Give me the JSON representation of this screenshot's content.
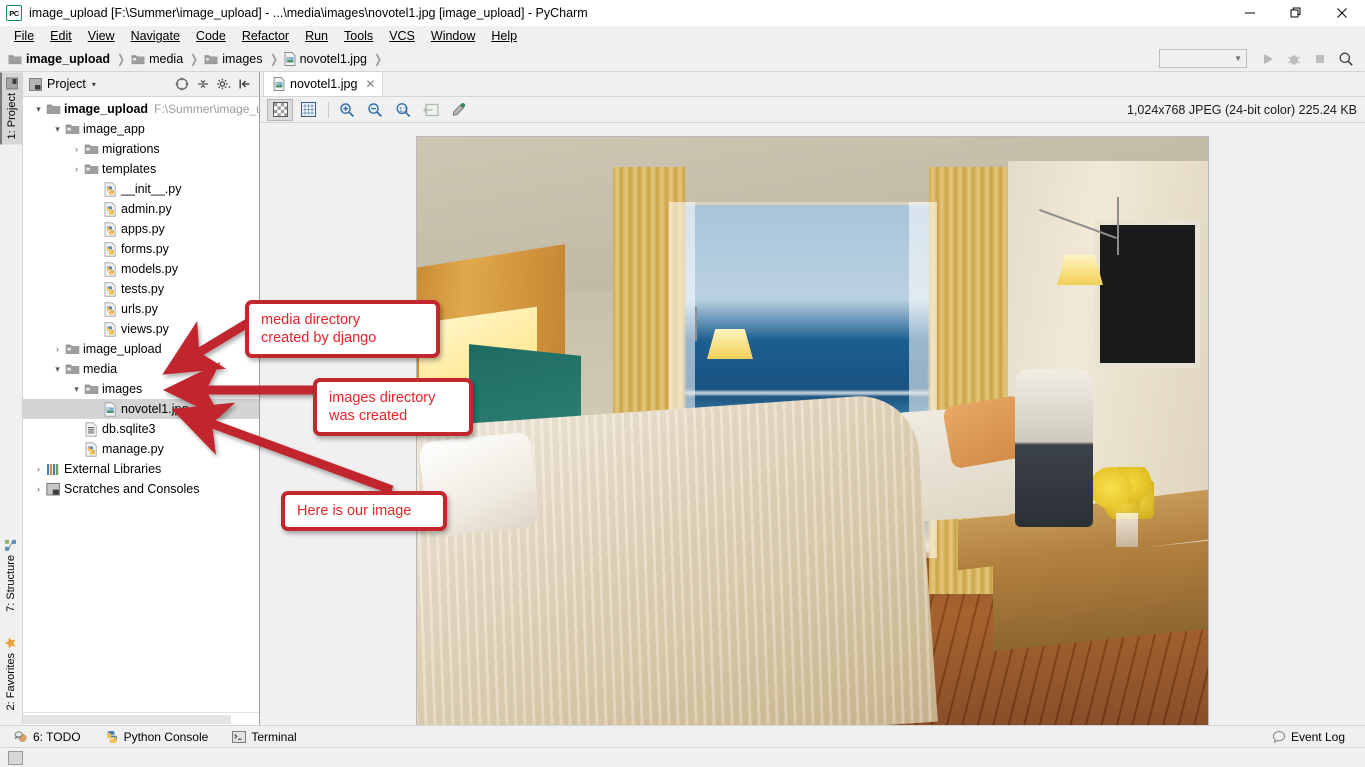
{
  "window": {
    "title": "image_upload [F:\\Summer\\image_upload] - ...\\media\\images\\novotel1.jpg [image_upload] - PyCharm",
    "app_icon_label": "PC",
    "minimize": "—",
    "maximize": "❐",
    "close": "✕"
  },
  "menubar": {
    "items": [
      {
        "label": "File"
      },
      {
        "label": "Edit"
      },
      {
        "label": "View"
      },
      {
        "label": "Navigate"
      },
      {
        "label": "Code"
      },
      {
        "label": "Refactor"
      },
      {
        "label": "Run"
      },
      {
        "label": "Tools"
      },
      {
        "label": "VCS"
      },
      {
        "label": "Window"
      },
      {
        "label": "Help"
      }
    ]
  },
  "navbar": {
    "breadcrumbs": [
      {
        "label": "image_upload",
        "icon": "folder-icon",
        "bold": true
      },
      {
        "label": "media",
        "icon": "folder-icon",
        "bold": false
      },
      {
        "label": "images",
        "icon": "folder-icon",
        "bold": false
      },
      {
        "label": "novotel1.jpg",
        "icon": "image-file-icon",
        "bold": false
      }
    ],
    "separator": "❯",
    "run_config_placeholder": "",
    "buttons": [
      {
        "name": "run-button",
        "label": "Run"
      },
      {
        "name": "debug-button",
        "label": "Debug"
      },
      {
        "name": "stop-button",
        "label": "Stop"
      },
      {
        "name": "search-everywhere-button",
        "label": "Search Everywhere"
      }
    ]
  },
  "left_stripe": {
    "top": [
      {
        "label": "1: Project",
        "icon": "project-icon",
        "active": true
      }
    ],
    "bottom": [
      {
        "label": "7: Structure",
        "icon": "structure-icon",
        "active": false
      },
      {
        "label": "2: Favorites",
        "icon": "favorites-star-icon",
        "active": false
      }
    ]
  },
  "project_panel": {
    "header_label": "Project",
    "header_caret": "▾",
    "tools": [
      "collapse-all-icon",
      "expand-all-icon",
      "settings-gear-icon",
      "hide-panel-icon"
    ],
    "tree": [
      {
        "label": "image_upload",
        "path": "F:\\Summer\\image_up",
        "indent": 0,
        "arrow": "▾",
        "icon": "folder-icon",
        "bold": true,
        "selected": false
      },
      {
        "label": "image_app",
        "path": "",
        "indent": 1,
        "arrow": "▾",
        "icon": "module-folder-icon",
        "bold": false,
        "selected": false
      },
      {
        "label": "migrations",
        "path": "",
        "indent": 2,
        "arrow": "›",
        "icon": "module-folder-icon",
        "bold": false,
        "selected": false
      },
      {
        "label": "templates",
        "path": "",
        "indent": 2,
        "arrow": "›",
        "icon": "module-folder-icon",
        "bold": false,
        "selected": false
      },
      {
        "label": "__init__.py",
        "path": "",
        "indent": 3,
        "arrow": "",
        "icon": "python-file-icon",
        "bold": false,
        "selected": false
      },
      {
        "label": "admin.py",
        "path": "",
        "indent": 3,
        "arrow": "",
        "icon": "python-file-icon",
        "bold": false,
        "selected": false
      },
      {
        "label": "apps.py",
        "path": "",
        "indent": 3,
        "arrow": "",
        "icon": "python-file-icon",
        "bold": false,
        "selected": false
      },
      {
        "label": "forms.py",
        "path": "",
        "indent": 3,
        "arrow": "",
        "icon": "python-file-icon",
        "bold": false,
        "selected": false
      },
      {
        "label": "models.py",
        "path": "",
        "indent": 3,
        "arrow": "",
        "icon": "python-file-icon",
        "bold": false,
        "selected": false
      },
      {
        "label": "tests.py",
        "path": "",
        "indent": 3,
        "arrow": "",
        "icon": "python-file-icon",
        "bold": false,
        "selected": false
      },
      {
        "label": "urls.py",
        "path": "",
        "indent": 3,
        "arrow": "",
        "icon": "python-file-icon",
        "bold": false,
        "selected": false
      },
      {
        "label": "views.py",
        "path": "",
        "indent": 3,
        "arrow": "",
        "icon": "python-file-icon",
        "bold": false,
        "selected": false
      },
      {
        "label": "image_upload",
        "path": "",
        "indent": 1,
        "arrow": "›",
        "icon": "module-folder-icon",
        "bold": false,
        "selected": false
      },
      {
        "label": "media",
        "path": "",
        "indent": 1,
        "arrow": "▾",
        "icon": "module-folder-icon",
        "bold": false,
        "selected": false
      },
      {
        "label": "images",
        "path": "",
        "indent": 2,
        "arrow": "▾",
        "icon": "module-folder-icon",
        "bold": false,
        "selected": false
      },
      {
        "label": "novotel1.jpg",
        "path": "",
        "indent": 3,
        "arrow": "",
        "icon": "image-file-icon",
        "bold": false,
        "selected": true
      },
      {
        "label": "db.sqlite3",
        "path": "",
        "indent": 2,
        "arrow": "",
        "icon": "db-file-icon",
        "bold": false,
        "selected": false
      },
      {
        "label": "manage.py",
        "path": "",
        "indent": 2,
        "arrow": "",
        "icon": "python-file-icon",
        "bold": false,
        "selected": false
      },
      {
        "label": "External Libraries",
        "path": "",
        "indent": 0,
        "arrow": "›",
        "icon": "libraries-icon",
        "bold": false,
        "selected": false
      },
      {
        "label": "Scratches and Consoles",
        "path": "",
        "indent": 0,
        "arrow": "›",
        "icon": "scratches-icon",
        "bold": false,
        "selected": false
      }
    ]
  },
  "editor": {
    "tab": {
      "label": "novotel1.jpg",
      "icon": "image-file-icon",
      "close": "✕"
    },
    "image_toolbar": [
      {
        "name": "toggle-transparency-grid-button",
        "icon": "checkerboard-icon",
        "pressed": true,
        "disabled": false
      },
      {
        "name": "toggle-grid-button",
        "icon": "grid-icon",
        "pressed": false,
        "disabled": false
      },
      {
        "name": "zoom-in-button",
        "icon": "zoom-in-icon",
        "pressed": false,
        "disabled": false
      },
      {
        "name": "zoom-out-button",
        "icon": "zoom-out-icon",
        "pressed": false,
        "disabled": false
      },
      {
        "name": "actual-size-button",
        "icon": "zoom-actual-size-icon",
        "pressed": false,
        "disabled": false
      },
      {
        "name": "fit-to-window-button",
        "icon": "fit-window-icon",
        "pressed": false,
        "disabled": true
      },
      {
        "name": "color-picker-button",
        "icon": "eyedropper-icon",
        "pressed": false,
        "disabled": false
      }
    ],
    "image_info": "1,024x768 JPEG (24-bit color) 225.24 KB"
  },
  "annotations": [
    {
      "name": "callout-media-directory",
      "text": "media directory\ncreated by django"
    },
    {
      "name": "callout-images-directory",
      "text": "images directory\nwas created"
    },
    {
      "name": "callout-here-is-our-image",
      "text": "Here is our image"
    }
  ],
  "annotation_color": "#c1272d",
  "toolwindow_bar": {
    "left": [
      {
        "label": "6: TODO",
        "icon": "todo-icon"
      },
      {
        "label": "Python Console",
        "icon": "python-console-icon"
      },
      {
        "label": "Terminal",
        "icon": "terminal-icon"
      }
    ],
    "right": [
      {
        "label": "Event Log",
        "icon": "event-log-icon"
      }
    ]
  }
}
